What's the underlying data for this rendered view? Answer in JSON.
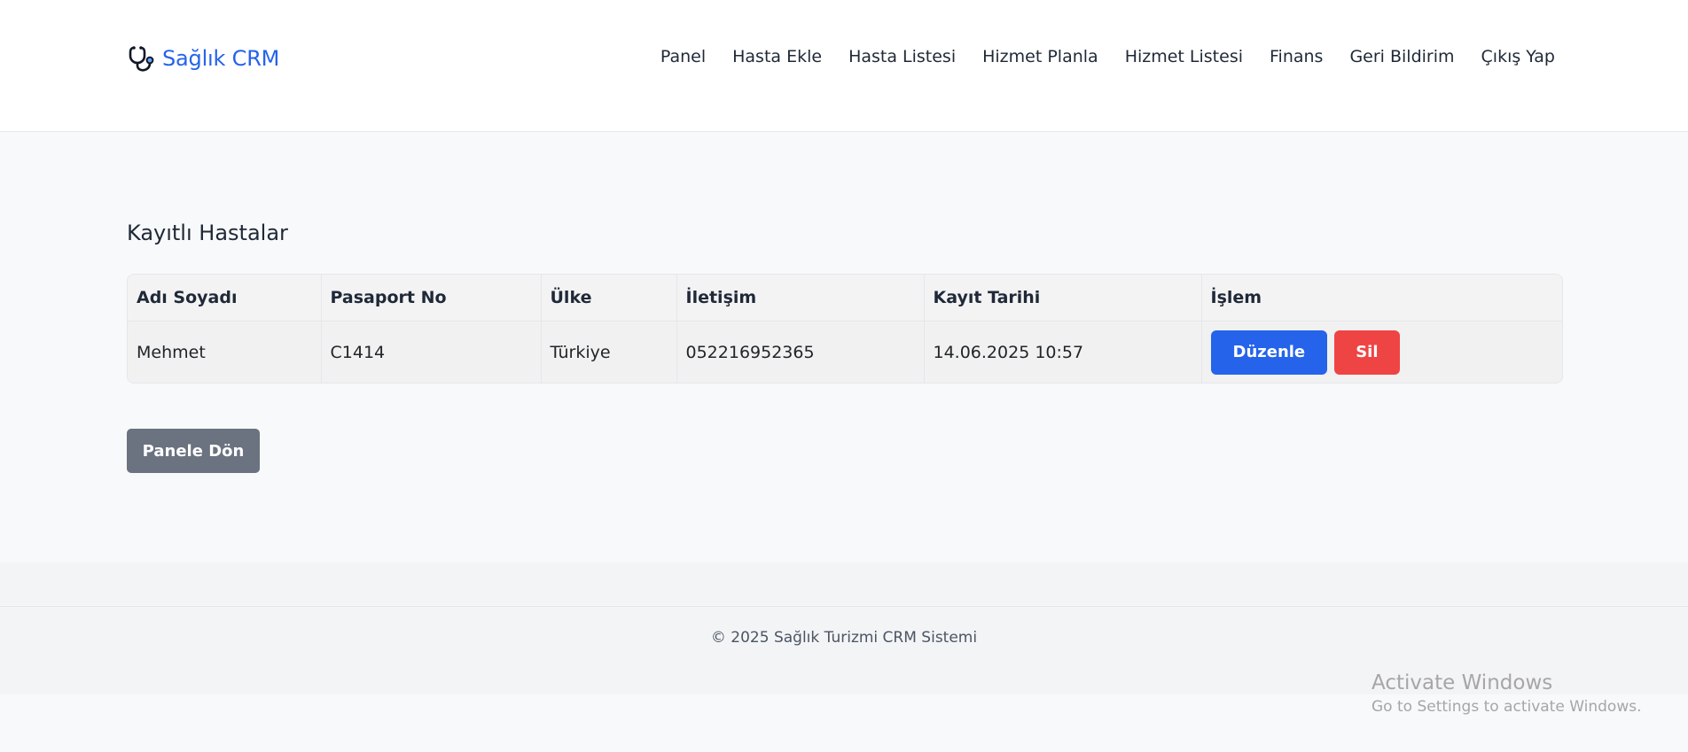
{
  "brand": {
    "name": "Sağlık CRM",
    "color": "#2563eb"
  },
  "nav": {
    "items": [
      {
        "label": "Panel"
      },
      {
        "label": "Hasta Ekle"
      },
      {
        "label": "Hasta Listesi"
      },
      {
        "label": "Hizmet Planla"
      },
      {
        "label": "Hizmet Listesi"
      },
      {
        "label": "Finans"
      },
      {
        "label": "Geri Bildirim"
      },
      {
        "label": "Çıkış Yap"
      }
    ]
  },
  "main": {
    "title": "Kayıtlı Hastalar",
    "table": {
      "columns": [
        "Adı Soyadı",
        "Pasaport No",
        "Ülke",
        "İletişim",
        "Kayıt Tarihi",
        "İşlem"
      ],
      "rows": [
        {
          "name": "Mehmet",
          "passport": "C1414",
          "country": "Türkiye",
          "contact": "052216952365",
          "registered": "14.06.2025 10:57",
          "edit_label": "Düzenle",
          "delete_label": "Sil"
        }
      ]
    },
    "back_label": "Panele Dön"
  },
  "footer": {
    "text": "© 2025 Sağlık Turizmi CRM Sistemi"
  },
  "watermark": {
    "title": "Activate Windows",
    "subtitle": "Go to Settings to activate Windows."
  },
  "colors": {
    "primary": "#2563eb",
    "danger": "#ef4444",
    "secondary": "#6b7280"
  },
  "icons": {
    "brand": "stethoscope-icon"
  }
}
